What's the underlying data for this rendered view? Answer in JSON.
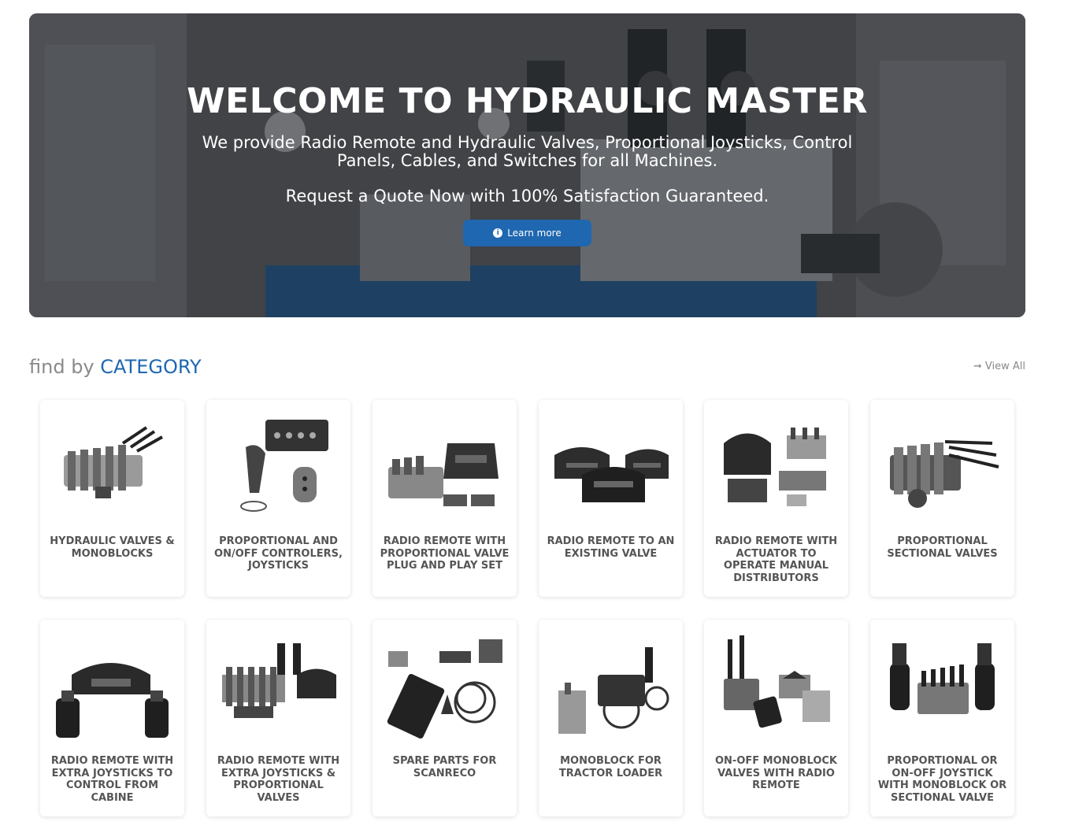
{
  "hero": {
    "title": "WELCOME TO HYDRAULIC MASTER",
    "subtitle": "We provide Radio Remote and Hydraulic Valves, Proportional Joysticks, Control Panels, Cables, and Switches for all Machines.",
    "quote": "Request a Quote Now with 100% Satisfaction Guaranteed.",
    "button_label": "Learn more",
    "button_icon": "info-icon"
  },
  "category_header": {
    "find_by": "find by",
    "category": "CATEGORY",
    "view_all": "➞ View All"
  },
  "categories": [
    {
      "label": "HYDRAULIC VALVES & MONOBLOCKS"
    },
    {
      "label": "PROPORTIONAL AND ON/OFF CONTROLERS, JOYSTICKS"
    },
    {
      "label": "RADIO REMOTE WITH PROPORTIONAL VALVE PLUG AND PLAY SET"
    },
    {
      "label": "RADIO REMOTE TO AN EXISTING VALVE"
    },
    {
      "label": "RADIO REMOTE WITH ACTUATOR TO OPERATE MANUAL DISTRIBUTORS"
    },
    {
      "label": "PROPORTIONAL SECTIONAL VALVES"
    },
    {
      "label": "RADIO REMOTE WITH EXTRA JOYSTICKS TO CONTROL FROM CABINE"
    },
    {
      "label": "RADIO REMOTE WITH EXTRA JOYSTICKS & PROPORTIONAL VALVES"
    },
    {
      "label": "SPARE PARTS FOR SCANRECO"
    },
    {
      "label": "MONOBLOCK FOR TRACTOR LOADER"
    },
    {
      "label": "ON-OFF MONOBLOCK VALVES WITH RADIO REMOTE"
    },
    {
      "label": "PROPORTIONAL OR ON-OFF JOYSTICK WITH MONOBLOCK OR SECTIONAL VALVE"
    }
  ],
  "colors": {
    "accent": "#1f67b0",
    "muted": "#8a8a8a"
  }
}
